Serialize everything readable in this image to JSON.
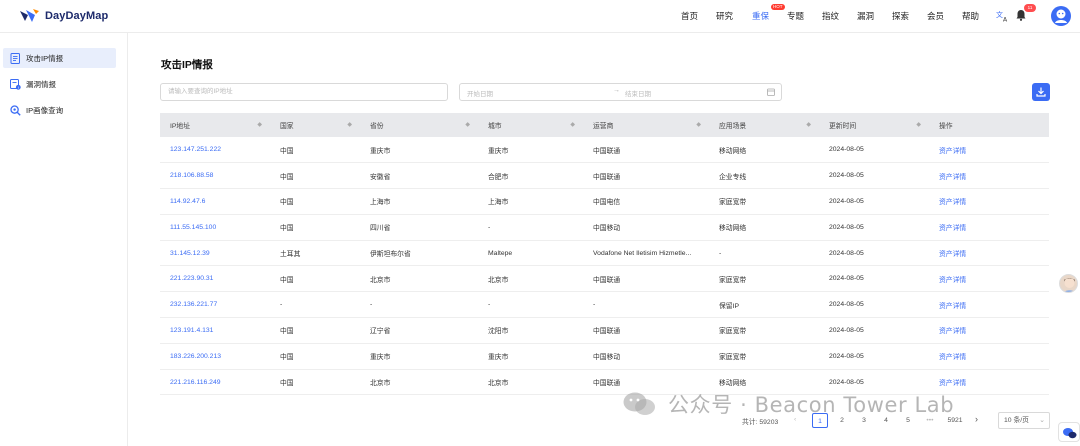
{
  "brand": {
    "name": "DayDayMap"
  },
  "nav": {
    "items": [
      "首页",
      "研究",
      "重保",
      "专题",
      "指纹",
      "漏洞",
      "探索",
      "会员",
      "帮助"
    ],
    "hot_badge": "HOT",
    "notification_count": "11"
  },
  "sidebar": {
    "items": [
      {
        "label": "攻击IP情报",
        "icon": "report-icon"
      },
      {
        "label": "漏洞情报",
        "icon": "bug-report-icon"
      },
      {
        "label": "IP画像查询",
        "icon": "search-icon"
      }
    ]
  },
  "page": {
    "title": "攻击IP情报",
    "search_placeholder": "请输入要查询的IP地址",
    "start_date_placeholder": "开始日期",
    "end_date_placeholder": "结束日期"
  },
  "table": {
    "columns": [
      "IP地址",
      "国家",
      "省份",
      "城市",
      "运营商",
      "应用场景",
      "更新时间",
      "操作"
    ],
    "rows": [
      [
        "123.147.251.222",
        "中国",
        "重庆市",
        "重庆市",
        "中国联通",
        "移动网络",
        "2024-08-05",
        "资产详情"
      ],
      [
        "218.106.88.58",
        "中国",
        "安徽省",
        "合肥市",
        "中国联通",
        "企业专线",
        "2024-08-05",
        "资产详情"
      ],
      [
        "114.92.47.6",
        "中国",
        "上海市",
        "上海市",
        "中国电信",
        "家庭宽带",
        "2024-08-05",
        "资产详情"
      ],
      [
        "111.55.145.100",
        "中国",
        "四川省",
        "-",
        "中国移动",
        "移动网络",
        "2024-08-05",
        "资产详情"
      ],
      [
        "31.145.12.39",
        "土耳其",
        "伊斯坦布尔省",
        "Maltepe",
        "Vodafone Net Iletisim Hizmetle...",
        "-",
        "2024-08-05",
        "资产详情"
      ],
      [
        "221.223.90.31",
        "中国",
        "北京市",
        "北京市",
        "中国联通",
        "家庭宽带",
        "2024-08-05",
        "资产详情"
      ],
      [
        "232.136.221.77",
        "-",
        "-",
        "-",
        "-",
        "保留IP",
        "2024-08-05",
        "资产详情"
      ],
      [
        "123.191.4.131",
        "中国",
        "辽宁省",
        "沈阳市",
        "中国联通",
        "家庭宽带",
        "2024-08-05",
        "资产详情"
      ],
      [
        "183.226.200.213",
        "中国",
        "重庆市",
        "重庆市",
        "中国移动",
        "家庭宽带",
        "2024-08-05",
        "资产详情"
      ],
      [
        "221.216.116.249",
        "中国",
        "北京市",
        "北京市",
        "中国联通",
        "移动网络",
        "2024-08-05",
        "资产详情"
      ]
    ]
  },
  "pagination": {
    "total_label": "共计: 59203",
    "prev": "‹",
    "pages": [
      "1",
      "2",
      "3",
      "4",
      "5",
      "•••",
      "5921"
    ],
    "next": "›",
    "page_size": "10 条/页"
  },
  "watermark": "公众号 · Beacon Tower Lab",
  "colors": {
    "accent": "#3b6cf4",
    "hot": "#ff3b30",
    "header_bg": "#e8e9ec"
  }
}
